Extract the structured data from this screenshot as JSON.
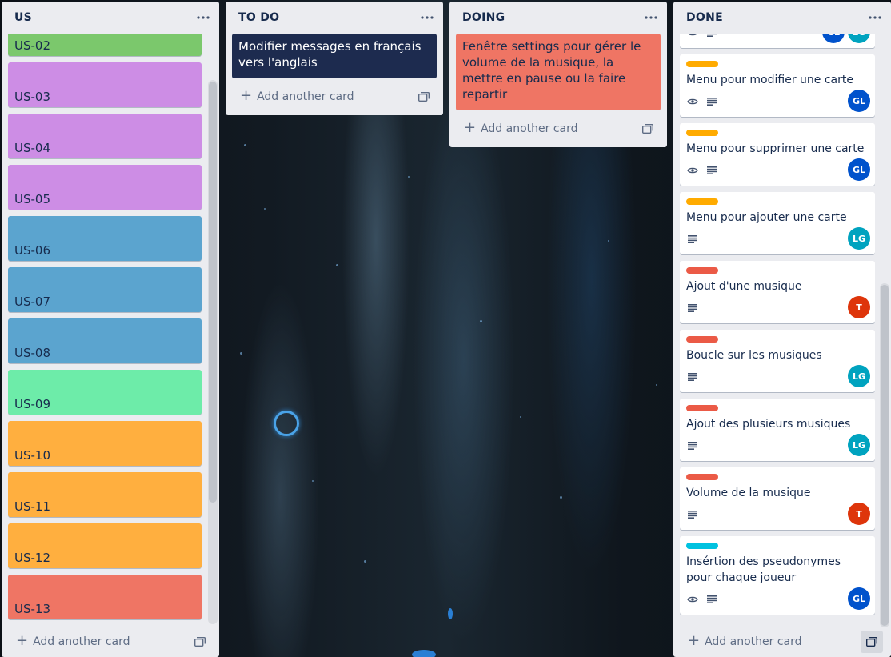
{
  "colors": {
    "list_bg": "#ebecf0",
    "green": "#7bc86c",
    "purple": "#cd8de5",
    "blue": "#5ba4cf",
    "mint": "#6deca9",
    "orange": "#ffaf3f",
    "red": "#ef7564",
    "navy": "#1d2b4f",
    "label_orange": "#ffab00",
    "label_red": "#eb5a46",
    "label_cyan": "#00c2e0",
    "avatar_gl": "#0052cc",
    "avatar_lg": "#00a3bf",
    "avatar_t": "#de350b"
  },
  "lists": {
    "us": {
      "title": "US",
      "cards": [
        {
          "label": "US-02",
          "color": "green"
        },
        {
          "label": "US-03",
          "color": "purple"
        },
        {
          "label": "US-04",
          "color": "purple"
        },
        {
          "label": "US-05",
          "color": "purple"
        },
        {
          "label": "US-06",
          "color": "blue"
        },
        {
          "label": "US-07",
          "color": "blue"
        },
        {
          "label": "US-08",
          "color": "blue"
        },
        {
          "label": "US-09",
          "color": "mint"
        },
        {
          "label": "US-10",
          "color": "orange"
        },
        {
          "label": "US-11",
          "color": "orange"
        },
        {
          "label": "US-12",
          "color": "orange"
        },
        {
          "label": "US-13",
          "color": "red"
        }
      ],
      "add_label": "Add another card"
    },
    "todo": {
      "title": "TO DO",
      "cards": [
        {
          "title": "Modifier messages en français vers l'anglais"
        }
      ],
      "add_label": "Add another card"
    },
    "doing": {
      "title": "DOING",
      "cards": [
        {
          "title": "Fenêtre settings pour gérer le volume de la musique, la mettre en pause ou la faire repartir"
        }
      ],
      "add_label": "Add another card"
    },
    "done": {
      "title": "DONE",
      "cards": [
        {
          "title": "",
          "label": null,
          "badges": [
            "eye",
            "desc"
          ],
          "members": [
            "GL",
            "LG"
          ]
        },
        {
          "title": "Menu pour modifier une carte",
          "label": "label_orange",
          "badges": [
            "eye",
            "desc"
          ],
          "members": [
            "GL"
          ]
        },
        {
          "title": "Menu pour supprimer une carte",
          "label": "label_orange",
          "badges": [
            "eye",
            "desc"
          ],
          "members": [
            "GL"
          ]
        },
        {
          "title": "Menu pour ajouter une carte",
          "label": "label_orange",
          "badges": [
            "desc"
          ],
          "members": [
            "LG"
          ]
        },
        {
          "title": "Ajout d'une musique",
          "label": "label_red",
          "badges": [
            "desc"
          ],
          "members": [
            "T"
          ]
        },
        {
          "title": "Boucle sur les musiques",
          "label": "label_red",
          "badges": [
            "desc"
          ],
          "members": [
            "LG"
          ]
        },
        {
          "title": "Ajout des plusieurs musiques",
          "label": "label_red",
          "badges": [
            "desc"
          ],
          "members": [
            "LG"
          ]
        },
        {
          "title": "Volume de la musique",
          "label": "label_red",
          "badges": [
            "desc"
          ],
          "members": [
            "T"
          ]
        },
        {
          "title": "Insértion des pseudonymes pour chaque joueur",
          "label": "label_cyan",
          "badges": [
            "eye",
            "desc"
          ],
          "members": [
            "GL"
          ]
        }
      ],
      "add_label": "Add another card"
    }
  }
}
